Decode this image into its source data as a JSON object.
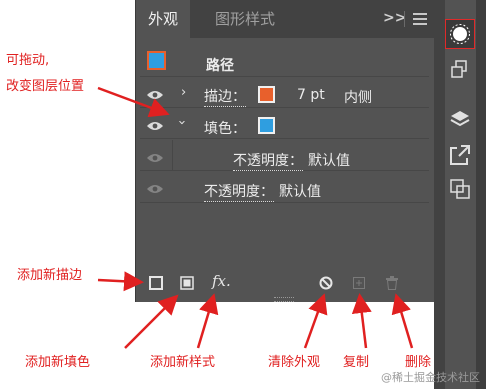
{
  "panel": {
    "tabs": [
      {
        "label": "外观",
        "active": true
      },
      {
        "label": "图形样式",
        "active": false
      }
    ],
    "more_label": ">>",
    "path_label": "路径",
    "stroke": {
      "label": "描边：",
      "weight": "7 pt",
      "align": "内侧",
      "color": "#e8602c"
    },
    "fill": {
      "label": "填色：",
      "color": "#2f9ee0"
    },
    "fill_opacity": {
      "label": "不透明度：",
      "value": "默认值"
    },
    "opacity": {
      "label": "不透明度：",
      "value": "默认值"
    },
    "fx_label": "fx."
  },
  "annotations": {
    "drag": "可拖动,",
    "drag2": "改变图层位置",
    "add_stroke": "添加新描边",
    "add_fill": "添加新填色",
    "add_style": "添加新样式",
    "clear": "清除外观",
    "duplicate": "复制",
    "delete": "删除"
  },
  "watermark": "@稀土掘金技术社区",
  "colors": {
    "annotation": "#e02020",
    "panel_bg": "#535353",
    "stroke_swatch": "#e8602c",
    "fill_swatch": "#2f9ee0"
  }
}
